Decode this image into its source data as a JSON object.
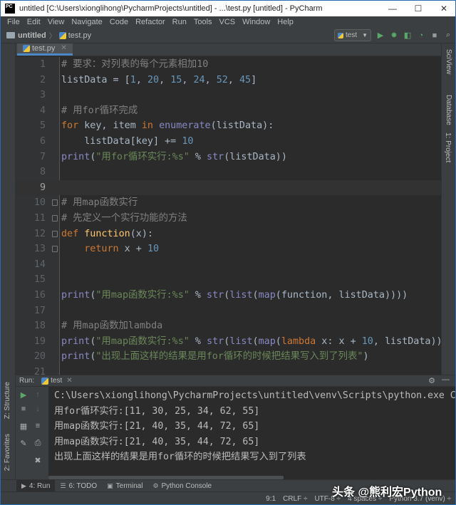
{
  "window": {
    "title": "untitled [C:\\Users\\xionglihong\\PycharmProjects\\untitled] - ...\\test.py [untitled] - PyCharm",
    "app_icon_text": "PC",
    "controls": {
      "minimize": "—",
      "maximize": "☐",
      "close": "✕"
    }
  },
  "menu": [
    "File",
    "Edit",
    "View",
    "Navigate",
    "Code",
    "Refactor",
    "Run",
    "Tools",
    "VCS",
    "Window",
    "Help"
  ],
  "navbar": {
    "project": "untitled",
    "file": "test.py",
    "run_config": "test"
  },
  "editor": {
    "tab_label": "test.py",
    "current_line": 9
  },
  "right_strip": {
    "tabs": [
      "SciView",
      "Database"
    ]
  },
  "left_strip": {
    "tabs": [
      "1: Project",
      "Z: Structure",
      "2: Favorites"
    ]
  },
  "run_panel": {
    "label": "Run:",
    "tab": "test",
    "console": [
      "C:\\Users\\xionglihong\\PycharmProjects\\untitled\\venv\\Scripts\\python.exe C:/Us",
      "用for循环实行:[11, 30, 25, 34, 62, 55]",
      "用map函数实行:[21, 40, 35, 44, 72, 65]",
      "用map函数实行:[21, 40, 35, 44, 72, 65]",
      "出现上面这样的结果是用for循环的时候把结果写入到了列表"
    ]
  },
  "tool_tabs": [
    {
      "icon": "▶",
      "label": "4: Run"
    },
    {
      "icon": "☰",
      "label": "6: TODO"
    },
    {
      "icon": "▣",
      "label": "Terminal"
    },
    {
      "icon": "⚙",
      "label": "Python Console"
    }
  ],
  "status": {
    "position": "9:1",
    "line_sep": "CRLF ÷",
    "encoding": "UTF-8 ÷",
    "indent": "4 spaces ÷",
    "interpreter": "Python 3.7 (venv) ÷"
  },
  "watermark": "头条 @熊利宏Python"
}
